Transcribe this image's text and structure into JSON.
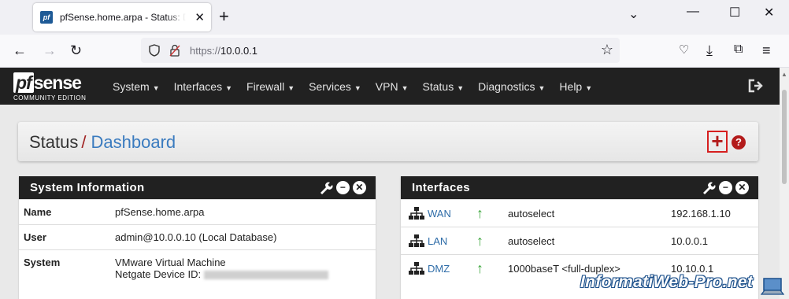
{
  "browser": {
    "tab_title": "pfSense.home.arpa - Status: Da",
    "tab_favicon": "pf",
    "url_proto": "https://",
    "url_host": "10.0.0.1"
  },
  "pfsense": {
    "logo_pf": "pf",
    "logo_sense": "sense",
    "logo_edition": "COMMUNITY EDITION",
    "menu": [
      "System",
      "Interfaces",
      "Firewall",
      "Services",
      "VPN",
      "Status",
      "Diagnostics",
      "Help"
    ],
    "breadcrumb": {
      "parent": "Status",
      "separator": "/",
      "current": "Dashboard"
    },
    "add_label": "+",
    "help_label": "?"
  },
  "system_info": {
    "title": "System Information",
    "rows": [
      {
        "key": "Name",
        "value": "pfSense.home.arpa"
      },
      {
        "key": "User",
        "value": "admin@10.0.0.10 (Local Database)"
      },
      {
        "key": "System",
        "value": "VMware Virtual Machine",
        "value2": "Netgate Device ID:"
      }
    ]
  },
  "interfaces": {
    "title": "Interfaces",
    "rows": [
      {
        "name": "WAN",
        "status": "up",
        "media": "autoselect",
        "ip": "192.168.1.10"
      },
      {
        "name": "LAN",
        "status": "up",
        "media": "autoselect",
        "ip": "10.0.0.1"
      },
      {
        "name": "DMZ",
        "status": "up",
        "media": "1000baseT <full-duplex>",
        "ip": "10.10.0.1"
      }
    ]
  },
  "watermark": "InformatiWeb-Pro.net",
  "colors": {
    "accent_red": "#b31b1b",
    "link_blue": "#2e6ca8",
    "navbar": "#212121",
    "status_up": "#3aa53a"
  }
}
